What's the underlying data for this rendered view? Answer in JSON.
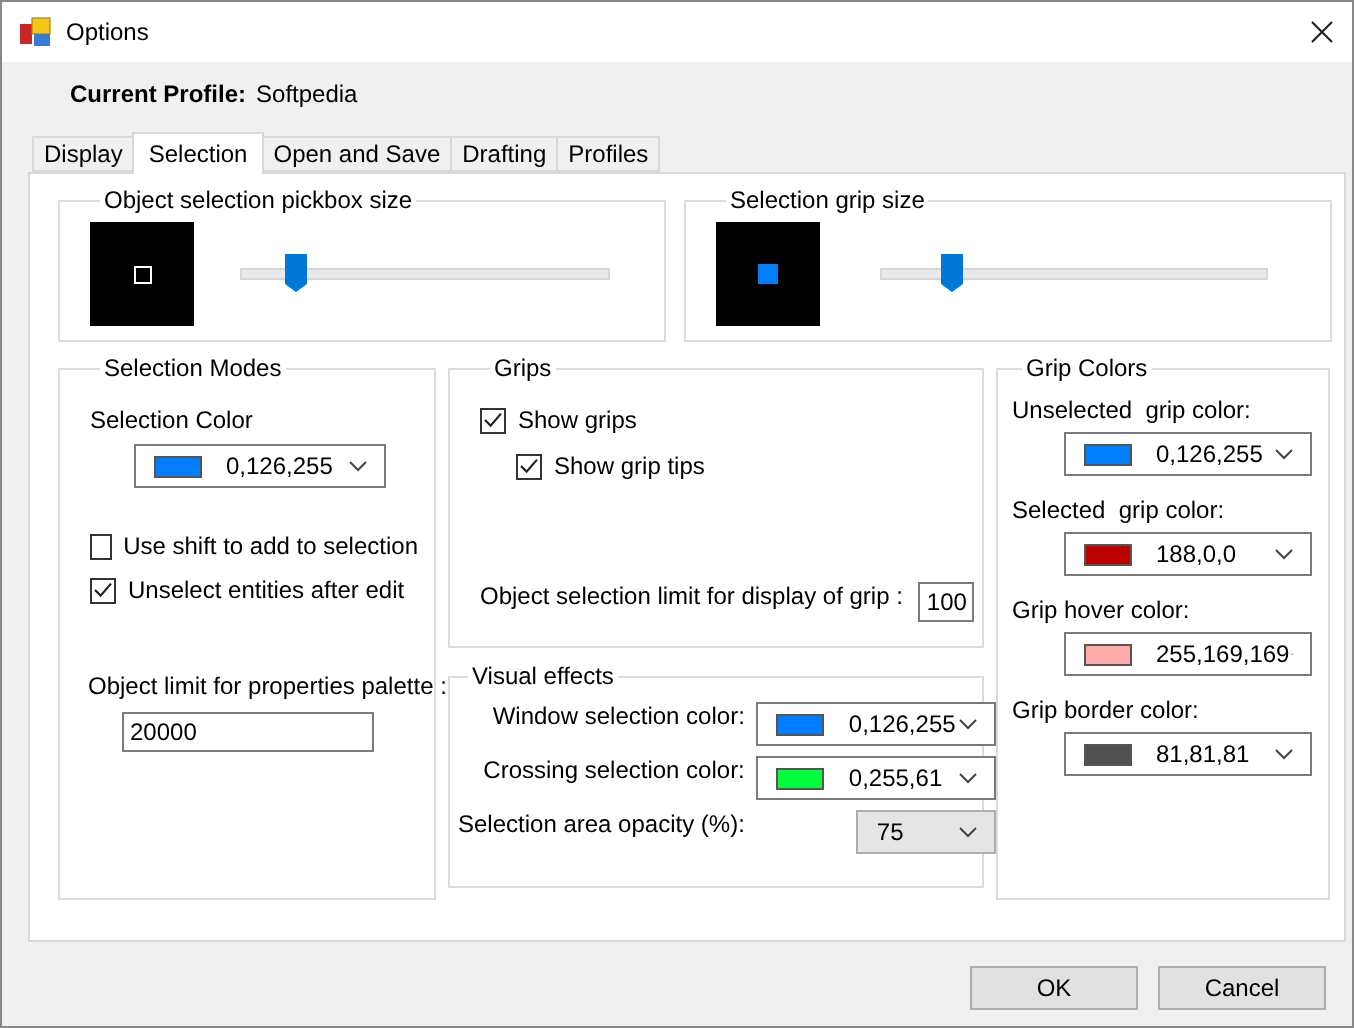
{
  "window": {
    "title": "Options"
  },
  "profile": {
    "label": "Current Profile:",
    "value": "Softpedia"
  },
  "tabs": [
    {
      "label": "Display",
      "selected": false
    },
    {
      "label": "Selection",
      "selected": true
    },
    {
      "label": "Open and Save",
      "selected": false
    },
    {
      "label": "Drafting",
      "selected": false
    },
    {
      "label": "Profiles",
      "selected": false
    }
  ],
  "size_groups": [
    {
      "title": "Object selection pickbox size",
      "kind": "pickbox",
      "level": 0.15
    },
    {
      "title": "Selection grip size",
      "kind": "grip",
      "level": 0.18
    }
  ],
  "selection_modes": {
    "title": "Selection Modes",
    "color_label": "Selection Color",
    "color": {
      "color": "#007eff",
      "value": "0,126,255"
    },
    "options": [
      {
        "label": "Use shift to add to selection",
        "checked": false
      },
      {
        "label": "Unselect entities after edit",
        "checked": true
      }
    ],
    "limit_label": "Object limit for properties palette :",
    "limit_value": "20000"
  },
  "grips": {
    "title": "Grips",
    "options": [
      {
        "label": "Show grips",
        "checked": true,
        "children": [
          {
            "label": "Show grip tips",
            "checked": true
          }
        ]
      }
    ],
    "limit_label": "Object selection limit for display of grip :",
    "limit_value": "100"
  },
  "visual_effects": {
    "title": "Visual effects",
    "rows": [
      {
        "label": "Window selection color:",
        "kind": "color",
        "color": "#007eff",
        "value": "0,126,255"
      },
      {
        "label": "Crossing selection color:",
        "kind": "color",
        "color": "#00ff3d",
        "value": "0,255,61"
      },
      {
        "label": "Selection area opacity (%):",
        "kind": "list",
        "value": "75"
      }
    ]
  },
  "grip_colors": {
    "title": "Grip Colors",
    "items": [
      {
        "label": "Unselected  grip color:",
        "color": "#007eff",
        "value": "0,126,255"
      },
      {
        "label": "Selected  grip color:",
        "color": "#bc0000",
        "value": "188,0,0"
      },
      {
        "label": "Grip hover color:",
        "color": "#ffa9a9",
        "value": "255,169,169"
      },
      {
        "label": "Grip border color:",
        "color": "#515151",
        "value": "81,81,81"
      }
    ]
  },
  "buttons": [
    "OK",
    "Cancel"
  ]
}
